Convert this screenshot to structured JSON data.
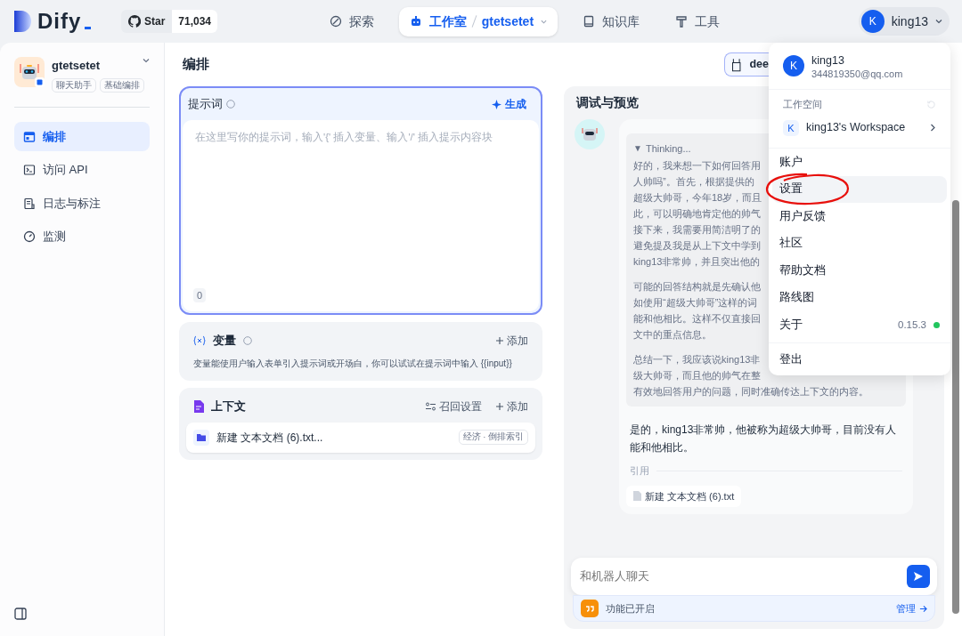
{
  "header": {
    "logo": "Dify",
    "github": {
      "label": "Star",
      "count": "71,034"
    },
    "nav": [
      {
        "label": "探索",
        "selected": false
      },
      {
        "label": "工作室",
        "selected": true,
        "app": "gtetsetet"
      },
      {
        "label": "知识库",
        "selected": false
      },
      {
        "label": "工具",
        "selected": false
      }
    ],
    "user": {
      "initial": "K",
      "name": "king13"
    }
  },
  "sidebar": {
    "app": {
      "name": "gtetsetet",
      "tags": [
        "聊天助手",
        "基础编排"
      ]
    },
    "items": [
      {
        "label": "编排",
        "selected": true
      },
      {
        "label": "访问 API",
        "selected": false
      },
      {
        "label": "日志与标注",
        "selected": false
      },
      {
        "label": "监测",
        "selected": false
      }
    ]
  },
  "config": {
    "title": "编排",
    "model_selector": {
      "label": "dee"
    },
    "prompt": {
      "title": "提示词",
      "generate": "生成",
      "placeholder": "在这里写你的提示词，输入'{' 插入变量、输入'/' 插入提示内容块",
      "count": "0"
    },
    "variables": {
      "title": "变量",
      "add": "添加",
      "hint": "变量能使用户输入表单引入提示词或开场白，你可以试试在提示词中输入 {{input}}"
    },
    "context": {
      "title": "上下文",
      "retrieval": "召回设置",
      "add": "添加",
      "files": [
        {
          "name": "新建 文本文档 (6).txt...",
          "tag": "经济 · 倒排索引"
        }
      ]
    }
  },
  "debug": {
    "title": "调试与预览",
    "thinking": {
      "toggle": "▼",
      "label": "Thinking...",
      "paragraphs": [
        [
          "好的，我来想一下如何回答用",
          "人帅吗”。首先，根据提供的",
          "超级大帅哥，今年18岁，而且",
          "此，可以明确地肯定他的帅气",
          "接下来，我需要用简洁明了的",
          "避免提及我是从上下文中学到",
          "king13非常帅，并且突出他的"
        ],
        [
          "可能的回答结构就是先确认他",
          "如使用“超级大帅哥”这样的词",
          "能和他相比。这样不仅直接回",
          "文中的重点信息。"
        ],
        [
          "总结一下，我应该说king13非",
          "级大帅哥，而且他的帅气在整",
          "有效地回答用户的问题，同时准确传达上下文的内容。"
        ]
      ]
    },
    "answer": "是的，king13非常帅，他被称为超级大帅哥，目前没有人能和他相比。",
    "citation_label": "引用",
    "citations": [
      "新建 文本文档 (6).txt"
    ],
    "input": {
      "placeholder": "和机器人聊天"
    },
    "feature": {
      "text": "功能已开启",
      "link": "管理"
    }
  },
  "user_menu": {
    "initial": "K",
    "name": "king13",
    "email": "344819350@qq.com",
    "workspace_label": "工作空间",
    "workspace": {
      "initial": "K",
      "name": "king13's Workspace"
    },
    "items": [
      {
        "label": "账户",
        "highlighted": false,
        "kind": "plain"
      },
      {
        "label": "设置",
        "highlighted": true,
        "kind": "plain"
      },
      {
        "label": "用户反馈",
        "highlighted": false,
        "kind": "plain"
      },
      {
        "label": "社区",
        "highlighted": false,
        "kind": "plain"
      },
      {
        "label": "帮助文档",
        "highlighted": false,
        "kind": "plain"
      },
      {
        "label": "路线图",
        "highlighted": false,
        "kind": "plain"
      },
      {
        "label": "关于",
        "highlighted": false,
        "kind": "about",
        "version": "0.15.3",
        "color": "#22c55e"
      }
    ],
    "logout": "登出"
  }
}
